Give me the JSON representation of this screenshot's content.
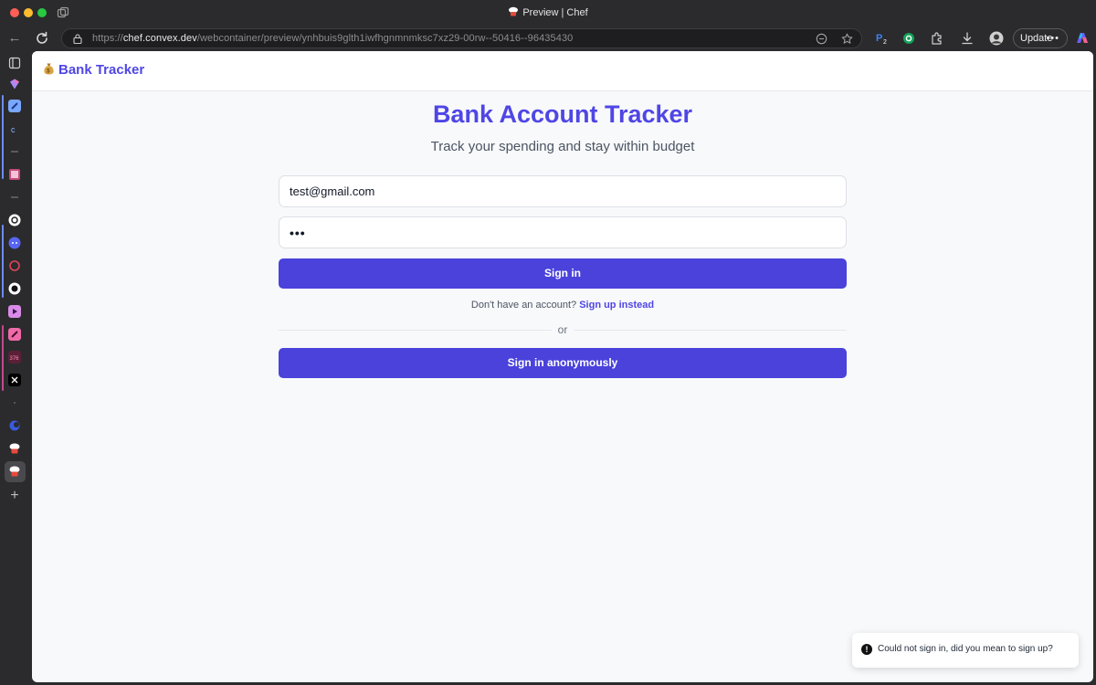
{
  "window": {
    "title": "Preview | Chef"
  },
  "toolbar": {
    "url_prefix": "https://",
    "url_host": "chef.convex.dev",
    "url_path": "/webcontainer/preview/ynhbuis9glth1iwfhgnmnmksc7xz29-00rw--50416--96435430",
    "extension_badge": "2",
    "update_label": "Update",
    "more_label": "•••"
  },
  "sidebar": {
    "items": [
      "tabs",
      "notion",
      "app-blue",
      "convex",
      "app-red",
      "openai",
      "discord",
      "app-ring",
      "github",
      "player",
      "pen-app",
      "counter-app",
      "x",
      "app-arc",
      "chef",
      "chef-active"
    ],
    "add_label": "+"
  },
  "app": {
    "brand": "Bank Tracker",
    "title": "Bank Account Tracker",
    "subtitle": "Track your spending and stay within budget",
    "email_value": "test@gmail.com",
    "password_masked": "•••",
    "sign_in_label": "Sign in",
    "switch_prompt": "Don't have an account?",
    "switch_link": "Sign up instead",
    "divider_label": "or",
    "anon_label": "Sign in anonymously"
  },
  "toast": {
    "message": "Could not sign in, did you mean to sign up?"
  },
  "colors": {
    "accent": "#4f46e5",
    "button": "#4a42db",
    "page_bg": "#f8f9fb"
  }
}
